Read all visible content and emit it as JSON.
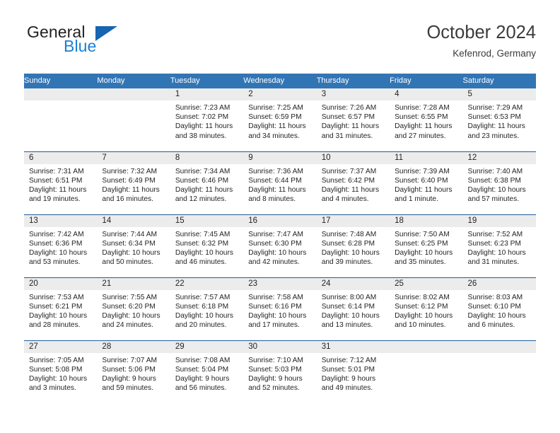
{
  "brand": {
    "word1": "General",
    "word2": "Blue",
    "logo_icon": "blue-triangle-logo",
    "accent_color": "#1b7fd4",
    "triangle_color": "#1565b0"
  },
  "header": {
    "title": "October 2024",
    "subtitle": "Kefenrod, Germany"
  },
  "theme": {
    "header_blue": "#3275b5",
    "rule_blue": "#1f5c9e",
    "daynum_band": "#ececec"
  },
  "weekday_headers": [
    "Sunday",
    "Monday",
    "Tuesday",
    "Wednesday",
    "Thursday",
    "Friday",
    "Saturday"
  ],
  "labels": {
    "sunrise": "Sunrise:",
    "sunset": "Sunset:",
    "daylight": "Daylight:"
  },
  "weeks": [
    [
      {
        "day": "",
        "blank": true
      },
      {
        "day": "",
        "blank": true
      },
      {
        "day": "1",
        "sunrise": "Sunrise: 7:23 AM",
        "sunset": "Sunset: 7:02 PM",
        "daylight_line1": "Daylight: 11 hours",
        "daylight_line2": "and 38 minutes."
      },
      {
        "day": "2",
        "sunrise": "Sunrise: 7:25 AM",
        "sunset": "Sunset: 6:59 PM",
        "daylight_line1": "Daylight: 11 hours",
        "daylight_line2": "and 34 minutes."
      },
      {
        "day": "3",
        "sunrise": "Sunrise: 7:26 AM",
        "sunset": "Sunset: 6:57 PM",
        "daylight_line1": "Daylight: 11 hours",
        "daylight_line2": "and 31 minutes."
      },
      {
        "day": "4",
        "sunrise": "Sunrise: 7:28 AM",
        "sunset": "Sunset: 6:55 PM",
        "daylight_line1": "Daylight: 11 hours",
        "daylight_line2": "and 27 minutes."
      },
      {
        "day": "5",
        "sunrise": "Sunrise: 7:29 AM",
        "sunset": "Sunset: 6:53 PM",
        "daylight_line1": "Daylight: 11 hours",
        "daylight_line2": "and 23 minutes."
      }
    ],
    [
      {
        "day": "6",
        "sunrise": "Sunrise: 7:31 AM",
        "sunset": "Sunset: 6:51 PM",
        "daylight_line1": "Daylight: 11 hours",
        "daylight_line2": "and 19 minutes."
      },
      {
        "day": "7",
        "sunrise": "Sunrise: 7:32 AM",
        "sunset": "Sunset: 6:49 PM",
        "daylight_line1": "Daylight: 11 hours",
        "daylight_line2": "and 16 minutes."
      },
      {
        "day": "8",
        "sunrise": "Sunrise: 7:34 AM",
        "sunset": "Sunset: 6:46 PM",
        "daylight_line1": "Daylight: 11 hours",
        "daylight_line2": "and 12 minutes."
      },
      {
        "day": "9",
        "sunrise": "Sunrise: 7:36 AM",
        "sunset": "Sunset: 6:44 PM",
        "daylight_line1": "Daylight: 11 hours",
        "daylight_line2": "and 8 minutes."
      },
      {
        "day": "10",
        "sunrise": "Sunrise: 7:37 AM",
        "sunset": "Sunset: 6:42 PM",
        "daylight_line1": "Daylight: 11 hours",
        "daylight_line2": "and 4 minutes."
      },
      {
        "day": "11",
        "sunrise": "Sunrise: 7:39 AM",
        "sunset": "Sunset: 6:40 PM",
        "daylight_line1": "Daylight: 11 hours",
        "daylight_line2": "and 1 minute."
      },
      {
        "day": "12",
        "sunrise": "Sunrise: 7:40 AM",
        "sunset": "Sunset: 6:38 PM",
        "daylight_line1": "Daylight: 10 hours",
        "daylight_line2": "and 57 minutes."
      }
    ],
    [
      {
        "day": "13",
        "sunrise": "Sunrise: 7:42 AM",
        "sunset": "Sunset: 6:36 PM",
        "daylight_line1": "Daylight: 10 hours",
        "daylight_line2": "and 53 minutes."
      },
      {
        "day": "14",
        "sunrise": "Sunrise: 7:44 AM",
        "sunset": "Sunset: 6:34 PM",
        "daylight_line1": "Daylight: 10 hours",
        "daylight_line2": "and 50 minutes."
      },
      {
        "day": "15",
        "sunrise": "Sunrise: 7:45 AM",
        "sunset": "Sunset: 6:32 PM",
        "daylight_line1": "Daylight: 10 hours",
        "daylight_line2": "and 46 minutes."
      },
      {
        "day": "16",
        "sunrise": "Sunrise: 7:47 AM",
        "sunset": "Sunset: 6:30 PM",
        "daylight_line1": "Daylight: 10 hours",
        "daylight_line2": "and 42 minutes."
      },
      {
        "day": "17",
        "sunrise": "Sunrise: 7:48 AM",
        "sunset": "Sunset: 6:28 PM",
        "daylight_line1": "Daylight: 10 hours",
        "daylight_line2": "and 39 minutes."
      },
      {
        "day": "18",
        "sunrise": "Sunrise: 7:50 AM",
        "sunset": "Sunset: 6:25 PM",
        "daylight_line1": "Daylight: 10 hours",
        "daylight_line2": "and 35 minutes."
      },
      {
        "day": "19",
        "sunrise": "Sunrise: 7:52 AM",
        "sunset": "Sunset: 6:23 PM",
        "daylight_line1": "Daylight: 10 hours",
        "daylight_line2": "and 31 minutes."
      }
    ],
    [
      {
        "day": "20",
        "sunrise": "Sunrise: 7:53 AM",
        "sunset": "Sunset: 6:21 PM",
        "daylight_line1": "Daylight: 10 hours",
        "daylight_line2": "and 28 minutes."
      },
      {
        "day": "21",
        "sunrise": "Sunrise: 7:55 AM",
        "sunset": "Sunset: 6:20 PM",
        "daylight_line1": "Daylight: 10 hours",
        "daylight_line2": "and 24 minutes."
      },
      {
        "day": "22",
        "sunrise": "Sunrise: 7:57 AM",
        "sunset": "Sunset: 6:18 PM",
        "daylight_line1": "Daylight: 10 hours",
        "daylight_line2": "and 20 minutes."
      },
      {
        "day": "23",
        "sunrise": "Sunrise: 7:58 AM",
        "sunset": "Sunset: 6:16 PM",
        "daylight_line1": "Daylight: 10 hours",
        "daylight_line2": "and 17 minutes."
      },
      {
        "day": "24",
        "sunrise": "Sunrise: 8:00 AM",
        "sunset": "Sunset: 6:14 PM",
        "daylight_line1": "Daylight: 10 hours",
        "daylight_line2": "and 13 minutes."
      },
      {
        "day": "25",
        "sunrise": "Sunrise: 8:02 AM",
        "sunset": "Sunset: 6:12 PM",
        "daylight_line1": "Daylight: 10 hours",
        "daylight_line2": "and 10 minutes."
      },
      {
        "day": "26",
        "sunrise": "Sunrise: 8:03 AM",
        "sunset": "Sunset: 6:10 PM",
        "daylight_line1": "Daylight: 10 hours",
        "daylight_line2": "and 6 minutes."
      }
    ],
    [
      {
        "day": "27",
        "sunrise": "Sunrise: 7:05 AM",
        "sunset": "Sunset: 5:08 PM",
        "daylight_line1": "Daylight: 10 hours",
        "daylight_line2": "and 3 minutes."
      },
      {
        "day": "28",
        "sunrise": "Sunrise: 7:07 AM",
        "sunset": "Sunset: 5:06 PM",
        "daylight_line1": "Daylight: 9 hours",
        "daylight_line2": "and 59 minutes."
      },
      {
        "day": "29",
        "sunrise": "Sunrise: 7:08 AM",
        "sunset": "Sunset: 5:04 PM",
        "daylight_line1": "Daylight: 9 hours",
        "daylight_line2": "and 56 minutes."
      },
      {
        "day": "30",
        "sunrise": "Sunrise: 7:10 AM",
        "sunset": "Sunset: 5:03 PM",
        "daylight_line1": "Daylight: 9 hours",
        "daylight_line2": "and 52 minutes."
      },
      {
        "day": "31",
        "sunrise": "Sunrise: 7:12 AM",
        "sunset": "Sunset: 5:01 PM",
        "daylight_line1": "Daylight: 9 hours",
        "daylight_line2": "and 49 minutes."
      },
      {
        "day": "",
        "blank": true
      },
      {
        "day": "",
        "blank": true
      }
    ]
  ]
}
